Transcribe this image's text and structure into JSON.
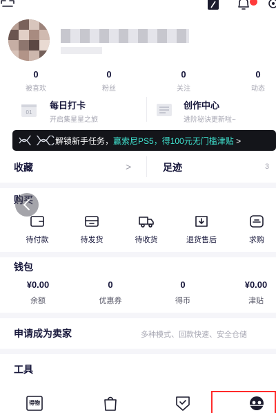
{
  "stats": [
    {
      "value": "0",
      "label": "被喜欢"
    },
    {
      "value": "0",
      "label": "粉丝"
    },
    {
      "value": "0",
      "label": "关注"
    },
    {
      "value": "0",
      "label": "动态"
    }
  ],
  "cards": {
    "checkin": {
      "title": "每日打卡",
      "subtitle": "开启集星星之旅"
    },
    "creator": {
      "title": "创作中心",
      "subtitle": "进阶秘诀更新啦~"
    }
  },
  "banner": {
    "prefix": "解锁新手任务，",
    "highlight": "赢索尼PS5，得100元无门槛津贴",
    "suffix": " >"
  },
  "rows": {
    "favorites": {
      "label": "收藏",
      "chevron": ">"
    },
    "footprints": {
      "label": "足迹",
      "count": "3"
    }
  },
  "orders": {
    "title": "购买",
    "items": [
      {
        "label": "待付款",
        "icon": "wallet-icon"
      },
      {
        "label": "待发货",
        "icon": "package-icon"
      },
      {
        "label": "待收货",
        "icon": "truck-icon"
      },
      {
        "label": "退货售后",
        "icon": "return-icon"
      },
      {
        "label": "求购",
        "icon": "want-icon"
      }
    ]
  },
  "wallet": {
    "title": "钱包",
    "items": [
      {
        "value": "¥0.00",
        "label": "余额"
      },
      {
        "value": "0",
        "label": "优惠券"
      },
      {
        "value": "0",
        "label": "得币"
      },
      {
        "value": "¥0.00",
        "label": "津贴"
      }
    ]
  },
  "seller": {
    "title": "申请成为卖家",
    "description": "多种模式、回款快速、安全仓储",
    "chevron": ">"
  },
  "tools": {
    "title": "工具",
    "items": [
      {
        "icon": "rebate-icon",
        "icon_text": "得物"
      },
      {
        "icon": "bag-icon"
      },
      {
        "icon": "shield-check-icon"
      },
      {
        "icon": "kefu-icon"
      }
    ]
  },
  "colors": {
    "accent": "#3fe3d0",
    "badge": "#ff3b3b",
    "highlight_box": "#ff2a2a",
    "text": "#16163a",
    "muted": "#a7a7b3"
  }
}
